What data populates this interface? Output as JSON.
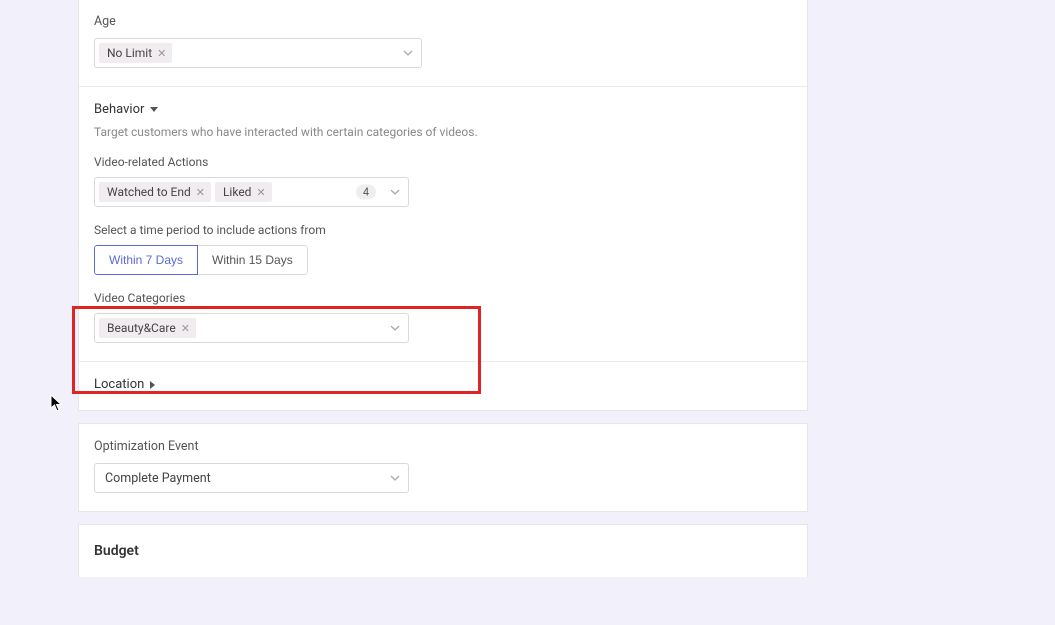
{
  "age": {
    "label": "Age",
    "chips": [
      {
        "text": "No Limit"
      }
    ]
  },
  "behavior": {
    "title": "Behavior",
    "description": "Target customers who have interacted with certain categories of videos.",
    "videoActions": {
      "label": "Video-related Actions",
      "chips": [
        {
          "text": "Watched to End"
        },
        {
          "text": "Liked"
        }
      ],
      "count": "4"
    },
    "timePeriod": {
      "label": "Select a time period to include actions from",
      "options": [
        "Within 7 Days",
        "Within 15 Days"
      ],
      "activeIndex": 0
    },
    "videoCategories": {
      "label": "Video Categories",
      "chips": [
        {
          "text": "Beauty&Care"
        }
      ]
    }
  },
  "location": {
    "title": "Location"
  },
  "optimizationEvent": {
    "label": "Optimization Event",
    "value": "Complete Payment"
  },
  "budget": {
    "title": "Budget"
  }
}
